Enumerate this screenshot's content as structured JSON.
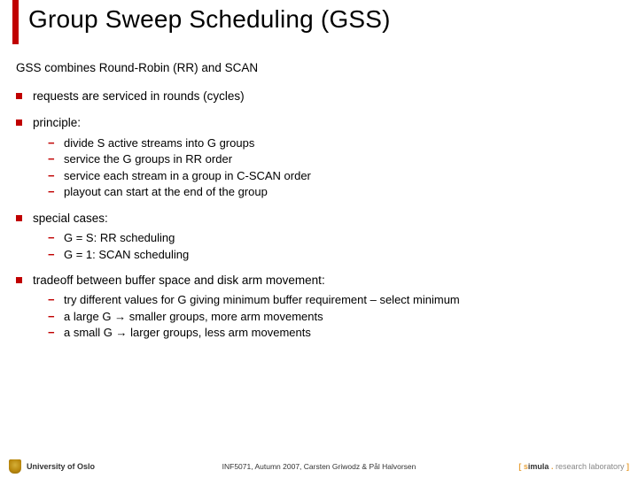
{
  "title": "Group Sweep Scheduling (GSS)",
  "intro": "GSS combines Round-Robin (RR) and SCAN",
  "bullets": [
    {
      "text": "requests are serviced in rounds (cycles)",
      "sub": []
    },
    {
      "text": "principle:",
      "sub": [
        "divide S active streams into G groups",
        "service the G groups in RR order",
        "service each stream in a group in C-SCAN order",
        "playout can start at the end of the group"
      ]
    },
    {
      "text": "special cases:",
      "sub": [
        "G = S: RR scheduling",
        "G = 1: SCAN scheduling"
      ]
    },
    {
      "text": "tradeoff between buffer space and disk arm movement:",
      "sub": [
        "try different values for G giving minimum buffer requirement – select minimum",
        "a large G → smaller groups, more arm movements",
        "a small G → larger groups, less arm movements"
      ]
    }
  ],
  "footer": {
    "uni": "University of Oslo",
    "course": "INF5071, Autumn 2007, Carsten Griwodz & Pål Halvorsen",
    "simula_open": "[ ",
    "simula_s": "s",
    "simula_rest": "imula",
    "simula_dot": " . ",
    "simula_lab": "research laboratory",
    "simula_close": " ]"
  }
}
